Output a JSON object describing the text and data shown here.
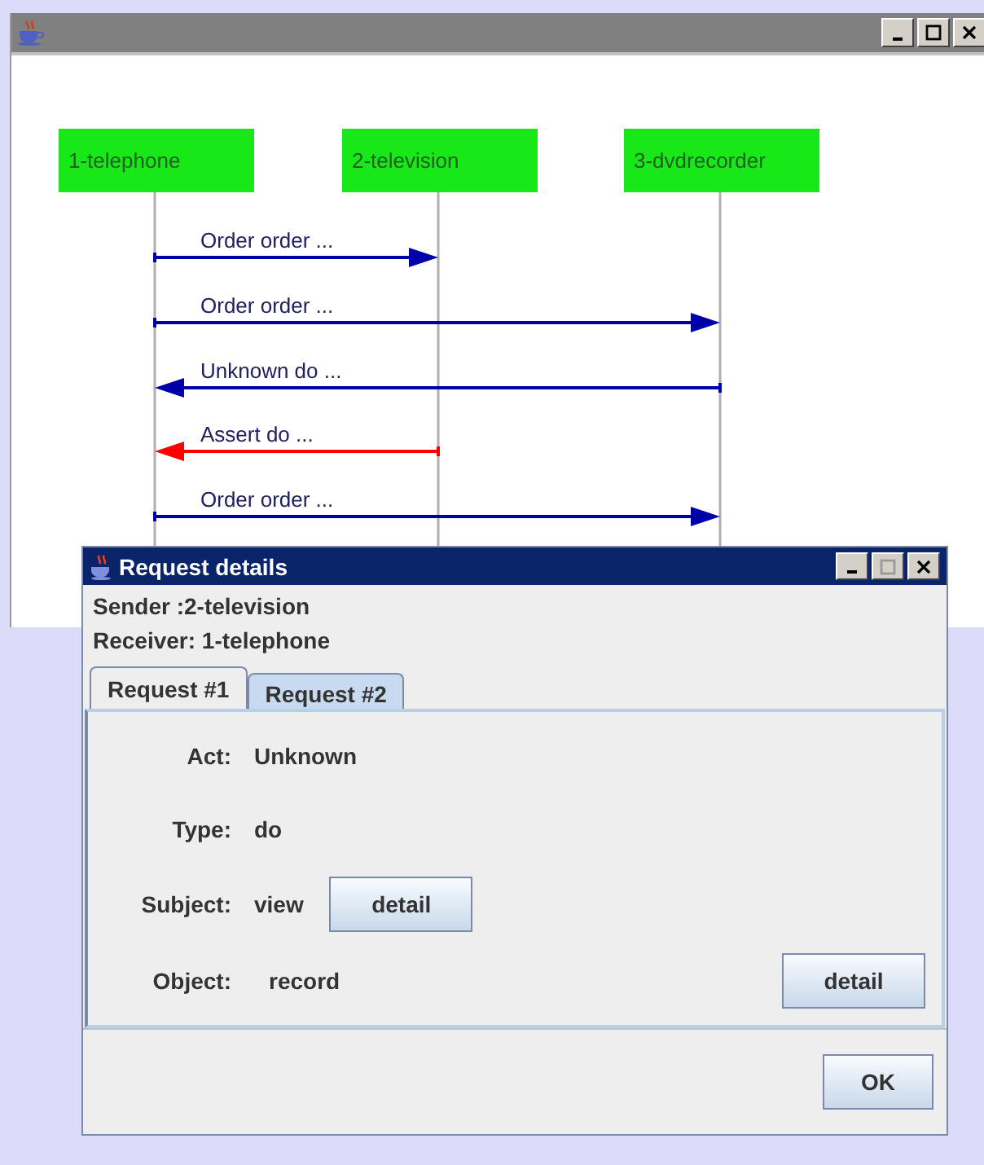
{
  "participants": [
    {
      "label": "1-telephone"
    },
    {
      "label": "2-television"
    },
    {
      "label": "3-dvdrecorder"
    }
  ],
  "messages": [
    {
      "label": "Order order ...",
      "color": "#0000a8"
    },
    {
      "label": "Order order ...",
      "color": "#0000a8"
    },
    {
      "label": "Unknown do ...",
      "color": "#0000a8"
    },
    {
      "label": "Assert do ...",
      "color": "#ff0000"
    },
    {
      "label": "Order order ...",
      "color": "#0000a8"
    }
  ],
  "dialog": {
    "title": "Request details",
    "sender": "Sender :2-television",
    "receiver": "Receiver: 1-telephone",
    "tabs": [
      {
        "label": "Request #1",
        "selected": true
      },
      {
        "label": "Request #2",
        "selected": false
      }
    ],
    "fields": [
      {
        "kind": "plain",
        "label": "Act:",
        "value": "Unknown"
      },
      {
        "kind": "plain",
        "label": "Type:",
        "value": "do"
      },
      {
        "kind": "inline",
        "label": "Subject:",
        "value": "view",
        "button": "detail"
      },
      {
        "kind": "right",
        "label": "Object:",
        "value": "record",
        "button": "detail"
      }
    ],
    "ok": "OK"
  }
}
